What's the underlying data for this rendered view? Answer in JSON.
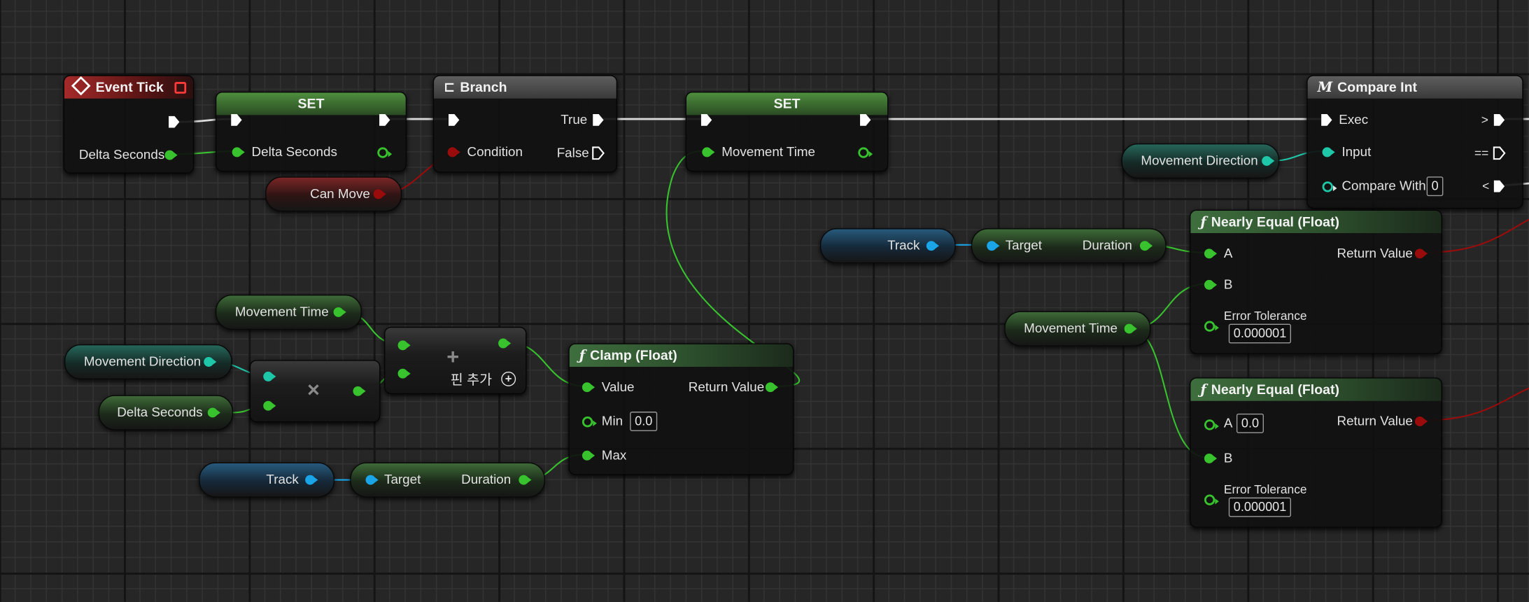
{
  "colors": {
    "exec": "#ffffff",
    "float": "#37c22e",
    "enum": "#1ec7a8",
    "object": "#1aa5e8",
    "bool": "#9a0c0c",
    "event_header": "#a52a2a",
    "function_header": "#3e6e3e"
  },
  "event_tick": {
    "title": "Event Tick",
    "icon": "diamond-event-icon",
    "delta_seconds": "Delta Seconds"
  },
  "set1": {
    "title": "SET",
    "pin": "Delta Seconds"
  },
  "branch": {
    "title": "Branch",
    "icon": "branch-icon",
    "condition": "Condition",
    "true_label": "True",
    "false_label": "False"
  },
  "can_move": {
    "label": "Can Move"
  },
  "set2": {
    "title": "SET",
    "pin": "Movement Time"
  },
  "compare_int": {
    "title": "Compare Int",
    "icon": "macro-icon",
    "exec": "Exec",
    "input": "Input",
    "compare_with": "Compare With",
    "compare_value": "0",
    "gt": ">",
    "eq": "==",
    "lt": "<"
  },
  "movement_direction_top": {
    "label": "Movement Direction"
  },
  "track_top": {
    "label": "Track"
  },
  "duration_top": {
    "target": "Target",
    "duration": "Duration"
  },
  "nearly_equal_1": {
    "title": "Nearly Equal (Float)",
    "a": "A",
    "b": "B",
    "return_value": "Return Value",
    "error_tolerance": "Error Tolerance",
    "tolerance_value": "0.000001"
  },
  "movement_time_right": {
    "label": "Movement Time"
  },
  "nearly_equal_2": {
    "title": "Nearly Equal (Float)",
    "a": "A",
    "a_value": "0.0",
    "b": "B",
    "return_value": "Return Value",
    "error_tolerance": "Error Tolerance",
    "tolerance_value": "0.000001"
  },
  "movement_time_left": {
    "label": "Movement Time"
  },
  "movement_direction_left": {
    "label": "Movement Direction"
  },
  "delta_seconds_left": {
    "label": "Delta Seconds"
  },
  "add_node": {
    "add_pin": "핀 추가",
    "plus": "+",
    "add_pin_icon": "plus-circle-icon"
  },
  "multiply_node": {
    "symbol": "×"
  },
  "clamp": {
    "title": "Clamp (Float)",
    "value": "Value",
    "return_value": "Return Value",
    "min": "Min",
    "min_value": "0.0",
    "max": "Max"
  },
  "track_bottom": {
    "label": "Track"
  },
  "duration_bottom": {
    "target": "Target",
    "duration": "Duration"
  }
}
